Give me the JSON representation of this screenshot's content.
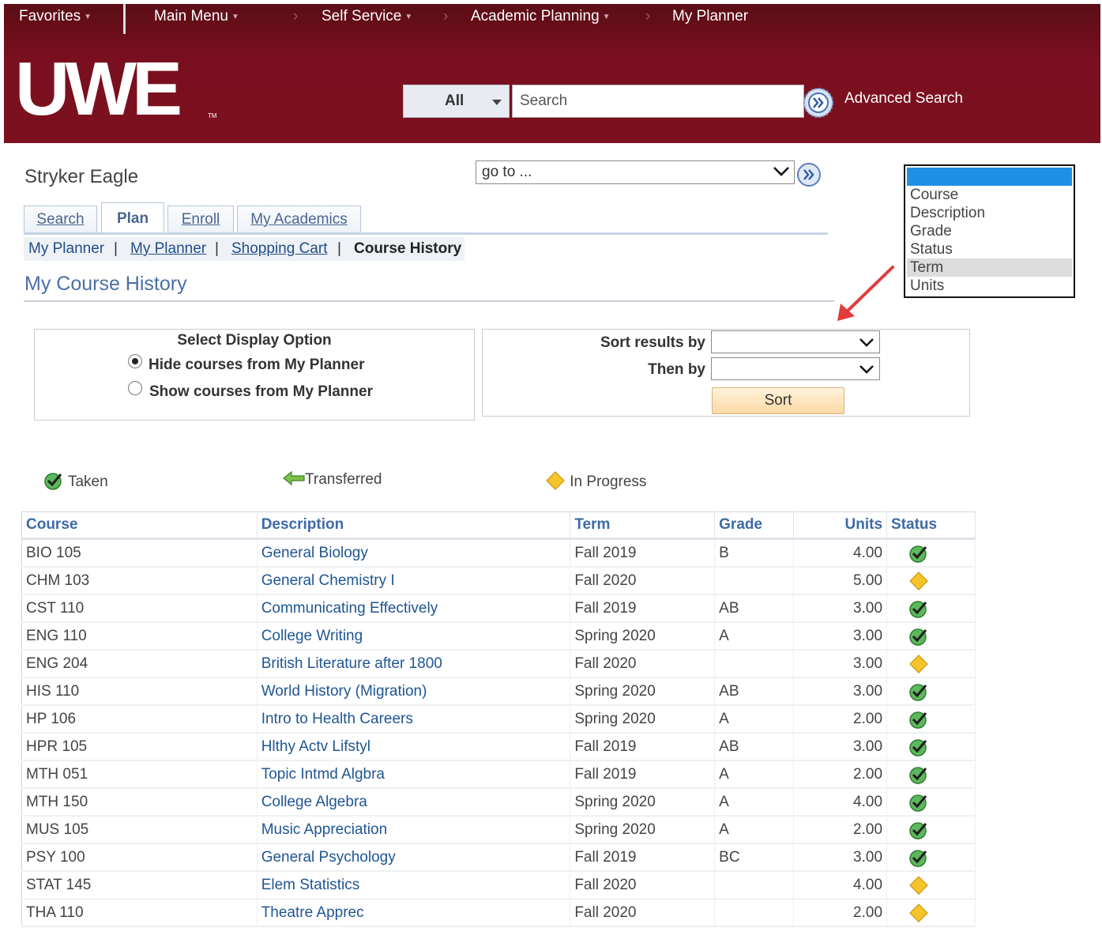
{
  "topnav": {
    "favorites": "Favorites",
    "main_menu": "Main Menu",
    "self_service": "Self Service",
    "academic_planning": "Academic Planning",
    "my_planner": "My Planner"
  },
  "brand": {
    "logo": "UWE",
    "tm": "TM"
  },
  "search": {
    "scope": "All",
    "placeholder": "Search",
    "advanced": "Advanced Search"
  },
  "person": {
    "name": "Stryker Eagle"
  },
  "goto": {
    "label": "go to ..."
  },
  "tabs": [
    {
      "label": "Search"
    },
    {
      "label": "Plan"
    },
    {
      "label": "Enroll"
    },
    {
      "label": "My Academics"
    }
  ],
  "subnav": {
    "items": [
      "My Planner",
      "My Planner",
      "Shopping Cart"
    ],
    "current": "Course History",
    "separator": "|"
  },
  "page": {
    "title": "My Course History"
  },
  "display_option": {
    "heading": "Select Display Option",
    "options": [
      {
        "label": "Hide courses from My Planner",
        "selected": true
      },
      {
        "label": "Show courses from My Planner",
        "selected": false
      }
    ]
  },
  "sort": {
    "sort_by_label": "Sort results by",
    "then_by_label": "Then by",
    "button": "Sort",
    "popup_options": [
      "Course",
      "Description",
      "Grade",
      "Status",
      "Term",
      "Units"
    ],
    "popup_highlighted": "Term"
  },
  "legend": {
    "taken": "Taken",
    "transferred": "Transferred",
    "in_progress": "In Progress"
  },
  "colors": {
    "header_bg": "#7a0f1f",
    "link": "#1f5592",
    "taken": "#3b9b3b",
    "in_progress": "#f5c518",
    "popup_selected_bar": "#1e90e6"
  },
  "table": {
    "columns": [
      "Course",
      "Description",
      "Term",
      "Grade",
      "Units",
      "Status"
    ],
    "rows": [
      {
        "course": "BIO 105",
        "description": "General Biology",
        "term": "Fall 2019",
        "grade": "B",
        "units": "4.00",
        "status": "taken"
      },
      {
        "course": "CHM 103",
        "description": "General Chemistry I",
        "term": "Fall 2020",
        "grade": "",
        "units": "5.00",
        "status": "in-progress"
      },
      {
        "course": "CST 110",
        "description": "Communicating Effectively",
        "term": "Fall 2019",
        "grade": "AB",
        "units": "3.00",
        "status": "taken"
      },
      {
        "course": "ENG 110",
        "description": "College Writing",
        "term": "Spring 2020",
        "grade": "A",
        "units": "3.00",
        "status": "taken"
      },
      {
        "course": "ENG 204",
        "description": "British Literature after 1800",
        "term": "Fall 2020",
        "grade": "",
        "units": "3.00",
        "status": "in-progress"
      },
      {
        "course": "HIS 110",
        "description": "World History (Migration)",
        "term": "Spring 2020",
        "grade": "AB",
        "units": "3.00",
        "status": "taken"
      },
      {
        "course": "HP 106",
        "description": "Intro to Health Careers",
        "term": "Spring 2020",
        "grade": "A",
        "units": "2.00",
        "status": "taken"
      },
      {
        "course": "HPR 105",
        "description": "Hlthy Actv Lifstyl",
        "term": "Fall 2019",
        "grade": "AB",
        "units": "3.00",
        "status": "taken"
      },
      {
        "course": "MTH 051",
        "description": "Topic Intmd Algbra",
        "term": "Fall 2019",
        "grade": "A",
        "units": "2.00",
        "status": "taken"
      },
      {
        "course": "MTH 150",
        "description": "College Algebra",
        "term": "Spring 2020",
        "grade": "A",
        "units": "4.00",
        "status": "taken"
      },
      {
        "course": "MUS 105",
        "description": "Music Appreciation",
        "term": "Spring 2020",
        "grade": "A",
        "units": "2.00",
        "status": "taken"
      },
      {
        "course": "PSY 100",
        "description": "General Psychology",
        "term": "Fall 2019",
        "grade": "BC",
        "units": "3.00",
        "status": "taken"
      },
      {
        "course": "STAT 145",
        "description": "Elem Statistics",
        "term": "Fall 2020",
        "grade": "",
        "units": "4.00",
        "status": "in-progress"
      },
      {
        "course": "THA 110",
        "description": "Theatre Apprec",
        "term": "Fall 2020",
        "grade": "",
        "units": "2.00",
        "status": "in-progress"
      }
    ]
  }
}
